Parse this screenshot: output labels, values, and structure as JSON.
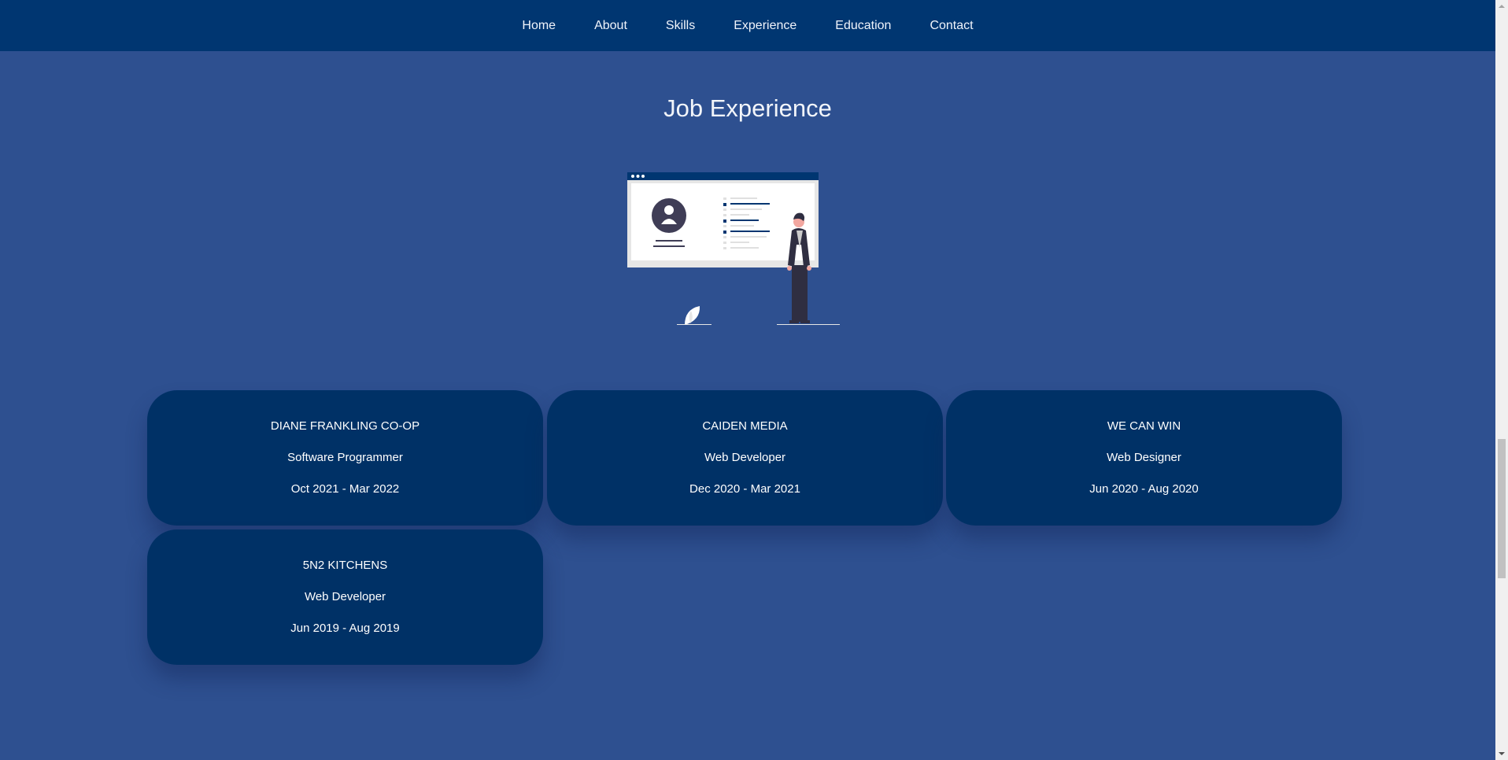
{
  "nav": {
    "items": [
      {
        "label": "Home"
      },
      {
        "label": "About"
      },
      {
        "label": "Skills"
      },
      {
        "label": "Experience"
      },
      {
        "label": "Education"
      },
      {
        "label": "Contact"
      }
    ]
  },
  "section": {
    "title": "Job Experience"
  },
  "jobs": [
    {
      "company": "DIANE FRANKLING CO-OP",
      "role": "Software Programmer",
      "dates": "Oct 2021 - Mar 2022"
    },
    {
      "company": "CAIDEN MEDIA",
      "role": "Web Developer",
      "dates": "Dec 2020 - Mar 2021"
    },
    {
      "company": "WE CAN WIN",
      "role": "Web Designer",
      "dates": "Jun 2020 - Aug 2020"
    },
    {
      "company": "5N2 KITCHENS",
      "role": "Web Developer",
      "dates": "Jun 2019 - Aug 2019"
    }
  ],
  "colors": {
    "page_bg": "#2e5090",
    "navbar_bg": "#003671",
    "card_bg": "#003166",
    "illustration_dark": "#3f3d56",
    "illustration_accent": "#003671"
  }
}
